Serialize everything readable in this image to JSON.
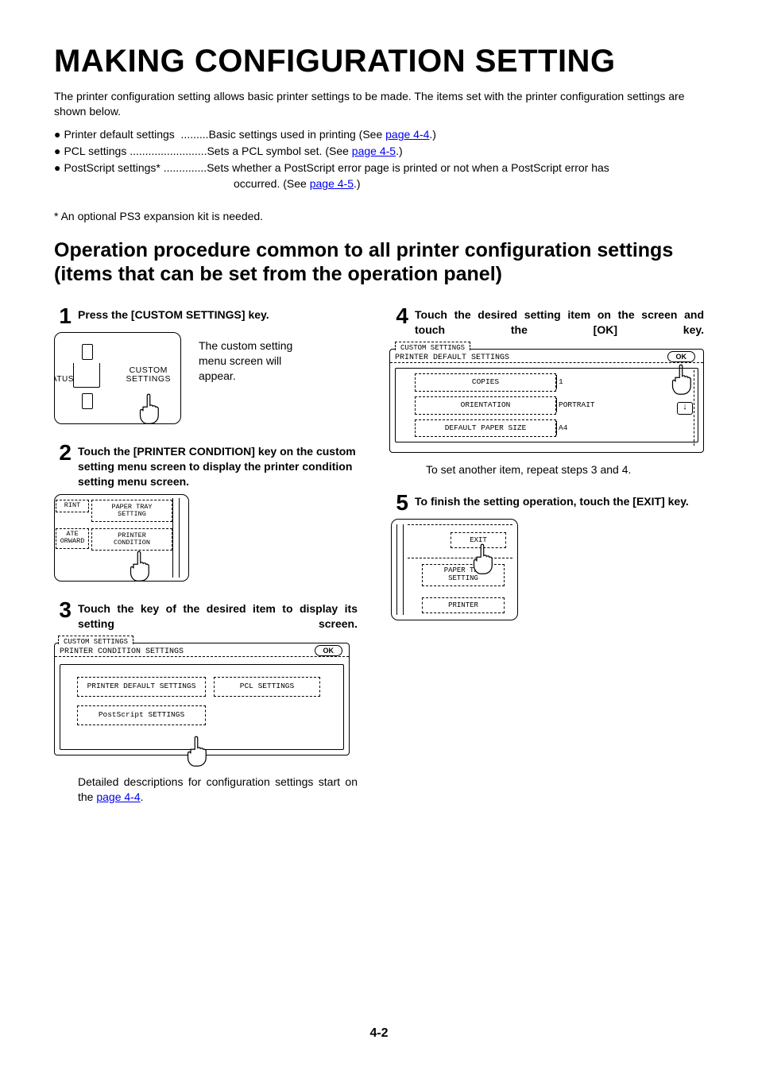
{
  "title": "MAKING CONFIGURATION SETTING",
  "intro": "The printer configuration setting allows basic printer settings to be made. The items set with the printer configuration settings are shown below.",
  "bullets": [
    {
      "label": "Printer default settings  .........",
      "desc_pre": "Basic settings used in printing (See ",
      "link": "page 4-4",
      "desc_post": ".)"
    },
    {
      "label": "PCL settings .........................",
      "desc_pre": "Sets a PCL symbol set. (See ",
      "link": "page 4-5",
      "desc_post": ".)"
    },
    {
      "label": "PostScript settings* ..............",
      "desc_pre": "Sets whether a PostScript error page is printed or not when a PostScript error has",
      "cont": "occurred. (See ",
      "link": "page 4-5",
      "desc_post": ".)"
    }
  ],
  "footnote": "* An optional PS3 expansion kit is needed.",
  "h2": "Operation procedure common to all printer configuration settings (items that can be set from the operation panel)",
  "steps": {
    "s1": {
      "num": "1",
      "title": "Press the [CUSTOM SETTINGS] key.",
      "side": "The custom setting menu screen will appear."
    },
    "s2": {
      "num": "2",
      "title": "Touch the [PRINTER CONDITION] key on the custom setting menu screen to display the printer condition setting menu screen."
    },
    "s3": {
      "num": "3",
      "title": "Touch the key of the desired item to display its setting screen.",
      "detail_pre": "Detailed descriptions for configuration settings start on the ",
      "link": "page 4-4",
      "detail_post": "."
    },
    "s4": {
      "num": "4",
      "title": "Touch the desired setting item on the screen and touch the [OK] key.",
      "note": "To set another item, repeat steps 3 and 4."
    },
    "s5": {
      "num": "5",
      "title": "To finish the setting operation, touch the [EXIT] key."
    }
  },
  "panel1": {
    "status": "ATUS",
    "label1": "CUSTOM",
    "label2": "SETTINGS"
  },
  "panel2": {
    "left1": "RINT",
    "left2a": "ATE",
    "left2b": "ORWARD",
    "btn1a": "PAPER TRAY",
    "btn1b": "SETTING",
    "btn2a": "PRINTER",
    "btn2b": "CONDITION"
  },
  "panel3": {
    "tab": "CUSTOM SETTINGS",
    "hdr": "PRINTER CONDITION SETTINGS",
    "ok": "OK",
    "b1": "PRINTER DEFAULT SETTINGS",
    "b2": "PCL SETTINGS",
    "b3": "PostScript SETTINGS"
  },
  "panel4": {
    "tab": "CUSTOM SETTINGS",
    "hdr": "PRINTER DEFAULT SETTINGS",
    "ok": "OK",
    "rows": [
      {
        "k": "COPIES",
        "v": "1"
      },
      {
        "k": "ORIENTATION",
        "v": "PORTRAIT"
      },
      {
        "k": "DEFAULT PAPER SIZE",
        "v": "A4"
      }
    ],
    "arrow": "↓"
  },
  "panel5": {
    "exit": "EXIT",
    "pts1": "PAPER TRA",
    "pts2": "SETTING",
    "pr": "PRINTER"
  },
  "pagenum": "4-2"
}
